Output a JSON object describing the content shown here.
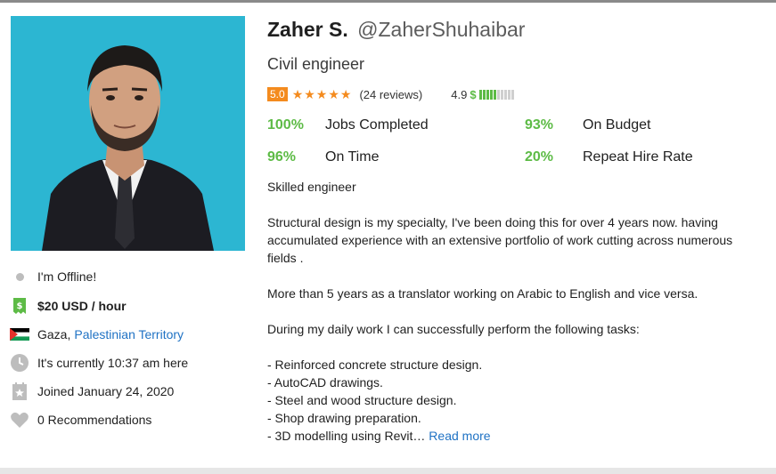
{
  "profile": {
    "name": "Zaher S.",
    "handle": "@ZaherShuhaibar",
    "title": "Civil engineer",
    "rating": "5.0",
    "reviews": "(24 reviews)",
    "earnings_score": "4.9",
    "earnings_symbol": "$",
    "earnings_level_fraction": 0.5
  },
  "stats": {
    "jobs_completed_pct": "100%",
    "jobs_completed_label": "Jobs Completed",
    "on_budget_pct": "93%",
    "on_budget_label": "On Budget",
    "on_time_pct": "96%",
    "on_time_label": "On Time",
    "repeat_hire_pct": "20%",
    "repeat_hire_label": "Repeat Hire Rate"
  },
  "sidebar": {
    "status": "I'm Offline!",
    "rate": "$20 USD / hour",
    "city": "Gaza,",
    "country": "Palestinian Territory",
    "local_time": "It's currently 10:37 am here",
    "joined": "Joined January 24, 2020",
    "recommendations": "0 Recommendations"
  },
  "description": {
    "headline": "Skilled engineer",
    "p1": "Structural design is my specialty, I've been doing this for over 4 years now. having accumulated experience with an extensive portfolio of work cutting across numerous fields .",
    "p2": "More than 5 years as a translator working on Arabic to English and vice versa.",
    "p3": "During my daily work I can successfully perform the following tasks:",
    "tasks": [
      "- Reinforced concrete structure design.",
      "- AutoCAD drawings.",
      "- Steel and wood structure design.",
      "- Shop drawing preparation.",
      "- 3D modelling using Revit…"
    ],
    "read_more": "Read more"
  },
  "colors": {
    "accent_green": "#5dbb46",
    "rating_orange": "#f48b1e",
    "link_blue": "#1f72c4",
    "photo_bg": "#2cb6d2"
  },
  "icons": [
    "offline-dot-icon",
    "dollar-bill-icon",
    "flag-icon",
    "clock-icon",
    "calendar-star-icon",
    "heart-icon"
  ]
}
